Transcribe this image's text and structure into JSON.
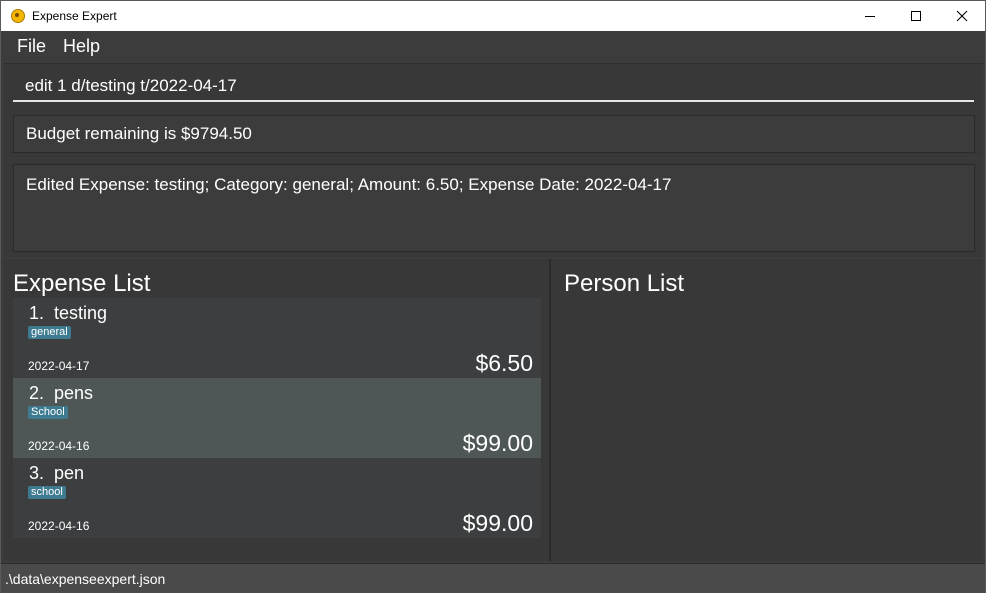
{
  "window": {
    "title": "Expense Expert",
    "icon": "coin-icon"
  },
  "menu": {
    "items": [
      "File",
      "Help"
    ]
  },
  "command": {
    "value": "edit 1 d/testing t/2022-04-17"
  },
  "budget": {
    "text": "Budget remaining is $9794.50"
  },
  "feedback": {
    "text": "Edited Expense: testing; Category: general; Amount: 6.50; Expense Date: 2022-04-17"
  },
  "expense_list": {
    "title": "Expense List",
    "items": [
      {
        "title": "1.  testing",
        "tag": "general",
        "date": "2022-04-17",
        "amount": "$6.50",
        "selected": false
      },
      {
        "title": "2.  pens",
        "tag": "School",
        "date": "2022-04-16",
        "amount": "$99.00",
        "selected": true
      },
      {
        "title": "3.  pen",
        "tag": "school",
        "date": "2022-04-16",
        "amount": "$99.00",
        "selected": false
      }
    ]
  },
  "person_list": {
    "title": "Person List"
  },
  "status": {
    "path": ".\\data\\expenseexpert.json"
  },
  "colors": {
    "background": "#3c3c3c",
    "selected_card": "#4f5656",
    "tag": "#3e7b91"
  }
}
